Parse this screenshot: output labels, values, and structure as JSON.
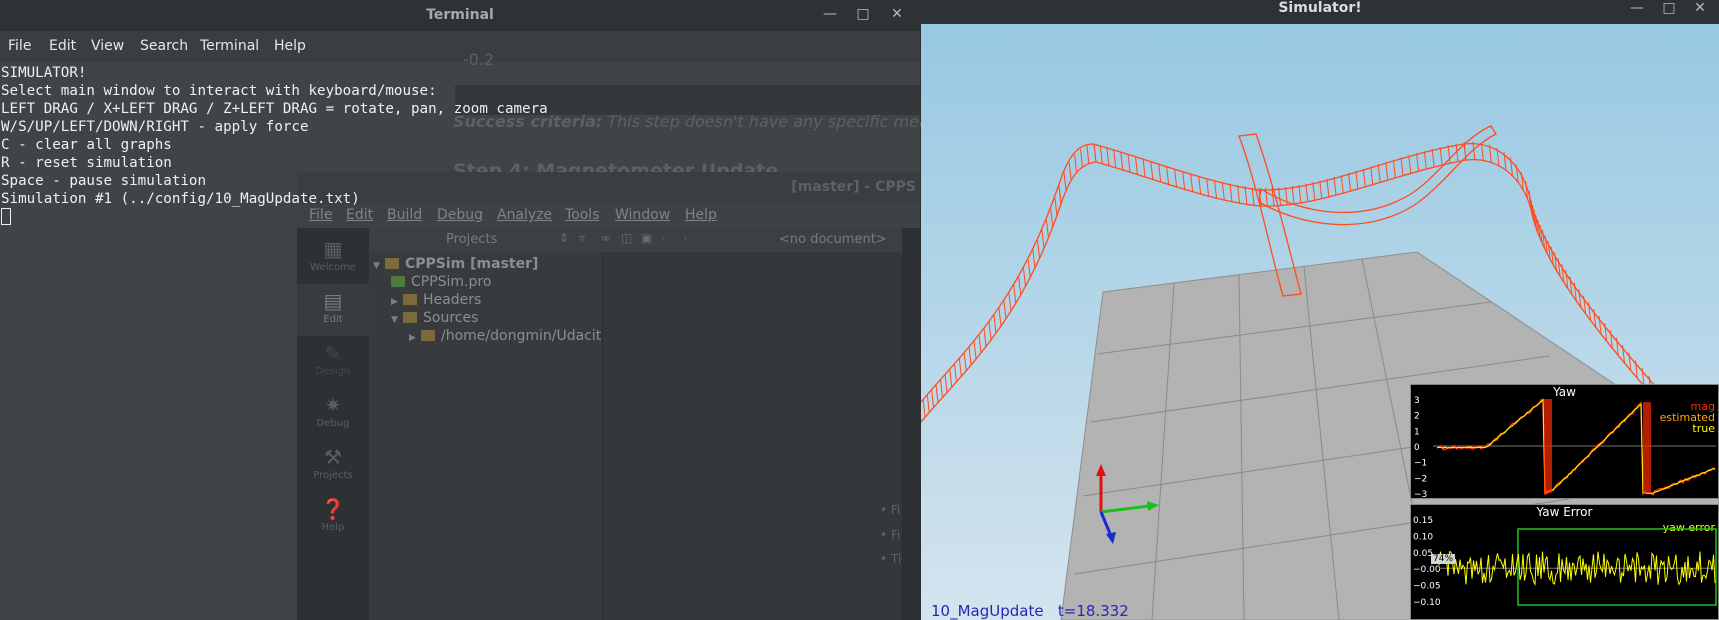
{
  "terminal": {
    "title": "Terminal",
    "menu": [
      "File",
      "Edit",
      "View",
      "Search",
      "Terminal",
      "Help"
    ],
    "lines": [
      "SIMULATOR!",
      "Select main window to interact with keyboard/mouse:",
      "LEFT DRAG / X+LEFT DRAG / Z+LEFT DRAG = rotate, pan, zoom camera",
      "W/S/UP/LEFT/DOWN/RIGHT - apply force",
      "C - clear all graphs",
      "R - reset simulation",
      "Space - pause simulation",
      "Simulation #1 (../config/10_MagUpdate.txt)"
    ]
  },
  "browser_ghost": {
    "value_fragment": "-0.2",
    "success_label": "Success criteria:",
    "success_text": "This step doesn't have any specific measurable",
    "heading": "Step 4: Magnetometer Update"
  },
  "qtcreator": {
    "title": "[master] - CPPS",
    "menu": [
      "File",
      "Edit",
      "Build",
      "Debug",
      "Analyze",
      "Tools",
      "Window",
      "Help"
    ],
    "projects_label": "Projects",
    "no_document": "<no document>",
    "modes": [
      {
        "label": "Welcome",
        "icon": "grid-icon"
      },
      {
        "label": "Edit",
        "icon": "edit-icon"
      },
      {
        "label": "Design",
        "icon": "design-icon"
      },
      {
        "label": "Debug",
        "icon": "bug-icon"
      },
      {
        "label": "Projects",
        "icon": "wrench-icon"
      },
      {
        "label": "Help",
        "icon": "help-icon"
      }
    ],
    "tree": {
      "root": "CPPSim [master]",
      "pro_file": "CPPSim.pro",
      "headers": "Headers",
      "sources": "Sources",
      "path": "/home/dongmin/Udacit"
    }
  },
  "simulator": {
    "title": "Simulator!",
    "scenario": "10_MagUpdate",
    "time_label": "t=18.332",
    "trajectory_color": "#ff4b1e",
    "sky_top": "#97c8e2",
    "sky_bottom": "#d4e4ee",
    "ground_color": "#b3b3b3"
  },
  "plots": {
    "yaw": {
      "title": "Yaw",
      "legend": [
        {
          "name": "mag",
          "color": "#ff2a00"
        },
        {
          "name": "estimated",
          "color": "#ffa500"
        },
        {
          "name": "true",
          "color": "#ffff00"
        }
      ],
      "y_ticks": [
        "3",
        "2",
        "1",
        "0",
        "−1",
        "−2",
        "−3"
      ]
    },
    "yaw_error": {
      "title": "Yaw Error",
      "legend": [
        {
          "name": "yaw error",
          "color": "#ffff00"
        }
      ],
      "y_ticks": [
        "0.15",
        "0.10",
        "0.05",
        "−0.00",
        "−0.05",
        "−0.10"
      ],
      "marker_label": "74%",
      "threshold_color": "#1fc41f"
    }
  }
}
